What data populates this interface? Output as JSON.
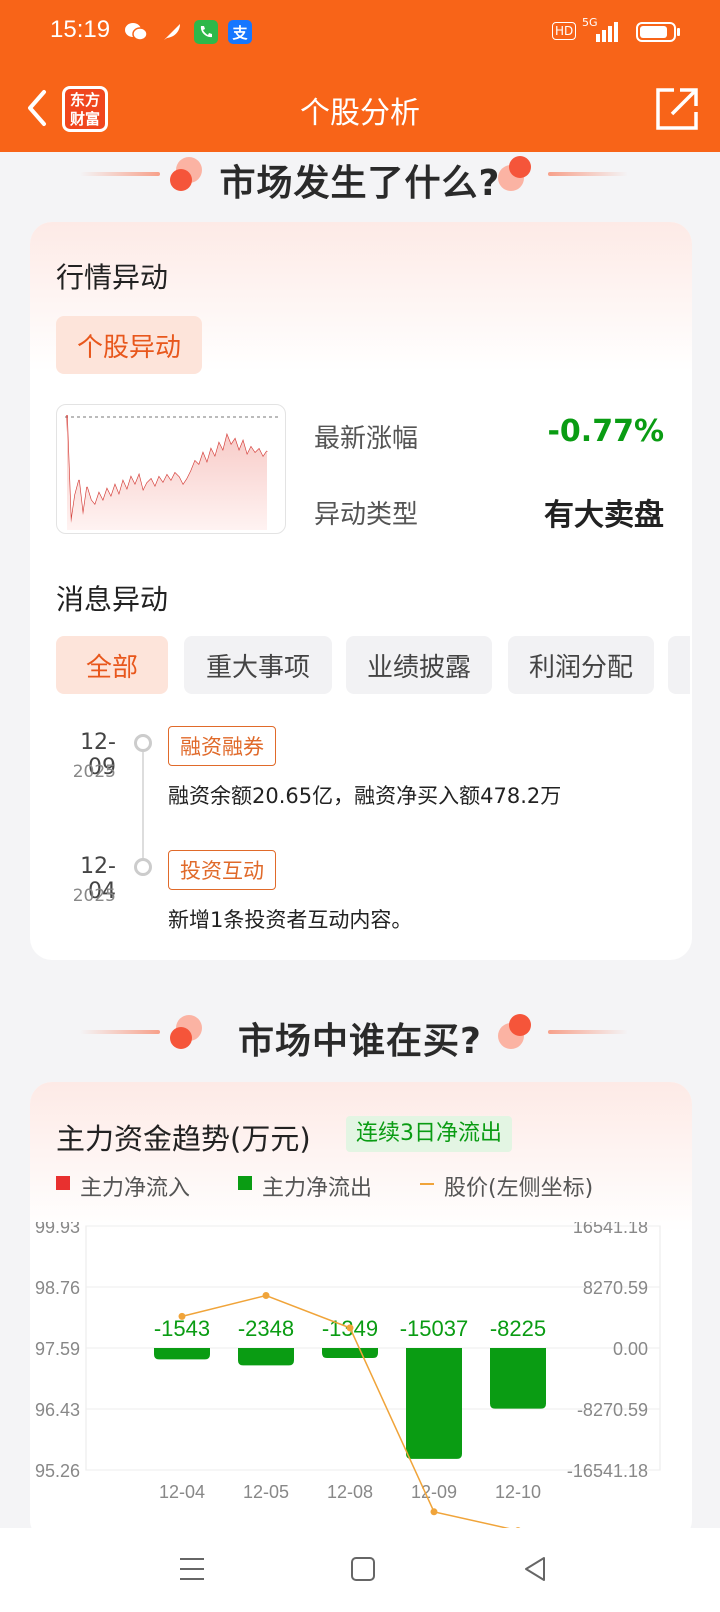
{
  "status_bar": {
    "time": "15:19",
    "network": "5G",
    "hd": "HD"
  },
  "header": {
    "title": "个股分析",
    "logo_line1": "东方",
    "logo_line2": "财富"
  },
  "section1": {
    "title": "市场发生了什么?"
  },
  "market_move": {
    "title": "行情异动",
    "chip": "个股异动",
    "latest_change_label": "最新涨幅",
    "latest_change_value": "-0.77%",
    "move_type_label": "异动类型",
    "move_type_value": "有大卖盘"
  },
  "news_move": {
    "title": "消息异动",
    "tabs": [
      "全部",
      "重大事项",
      "业绩披露",
      "利润分配"
    ],
    "items": [
      {
        "date": "12-09",
        "year": "2025",
        "tag": "融资融券",
        "text": "融资余额20.65亿，融资净买入额478.2万"
      },
      {
        "date": "12-04",
        "year": "2025",
        "tag": "投资互动",
        "text": "新增1条投资者互动内容。"
      }
    ]
  },
  "section2": {
    "title": "市场中谁在买?"
  },
  "fund_trend": {
    "title": "主力资金趋势(万元)",
    "badge": "连续3日净流出",
    "legend": [
      "主力净流入",
      "主力净流出",
      "股价(左侧坐标)"
    ],
    "colors": {
      "inflow": "#e8302f",
      "outflow": "#0a9c13",
      "price": "#f0a43a"
    }
  },
  "chart_data": {
    "type": "bar",
    "categories": [
      "12-04",
      "12-05",
      "12-08",
      "12-09",
      "12-10"
    ],
    "series": [
      {
        "name": "主力净流出",
        "values": [
          -1543,
          -2348,
          -1349,
          -15037,
          -8225
        ]
      },
      {
        "name": "股价(左侧坐标)",
        "values": [
          98.2,
          98.6,
          97.98,
          94.46,
          94.1
        ]
      }
    ],
    "data_labels": [
      "-1543",
      "-2348",
      "-1349",
      "-15037",
      "-8225"
    ],
    "y_left_ticks": [
      "99.93",
      "98.76",
      "97.59",
      "96.43",
      "95.26"
    ],
    "y_right_ticks": [
      "16541.18",
      "8270.59",
      "0.00",
      "-8270.59",
      "-16541.18"
    ],
    "y_left_range": [
      95.26,
      99.93
    ],
    "y_right_range": [
      -16541.18,
      16541.18
    ],
    "grid": true
  }
}
